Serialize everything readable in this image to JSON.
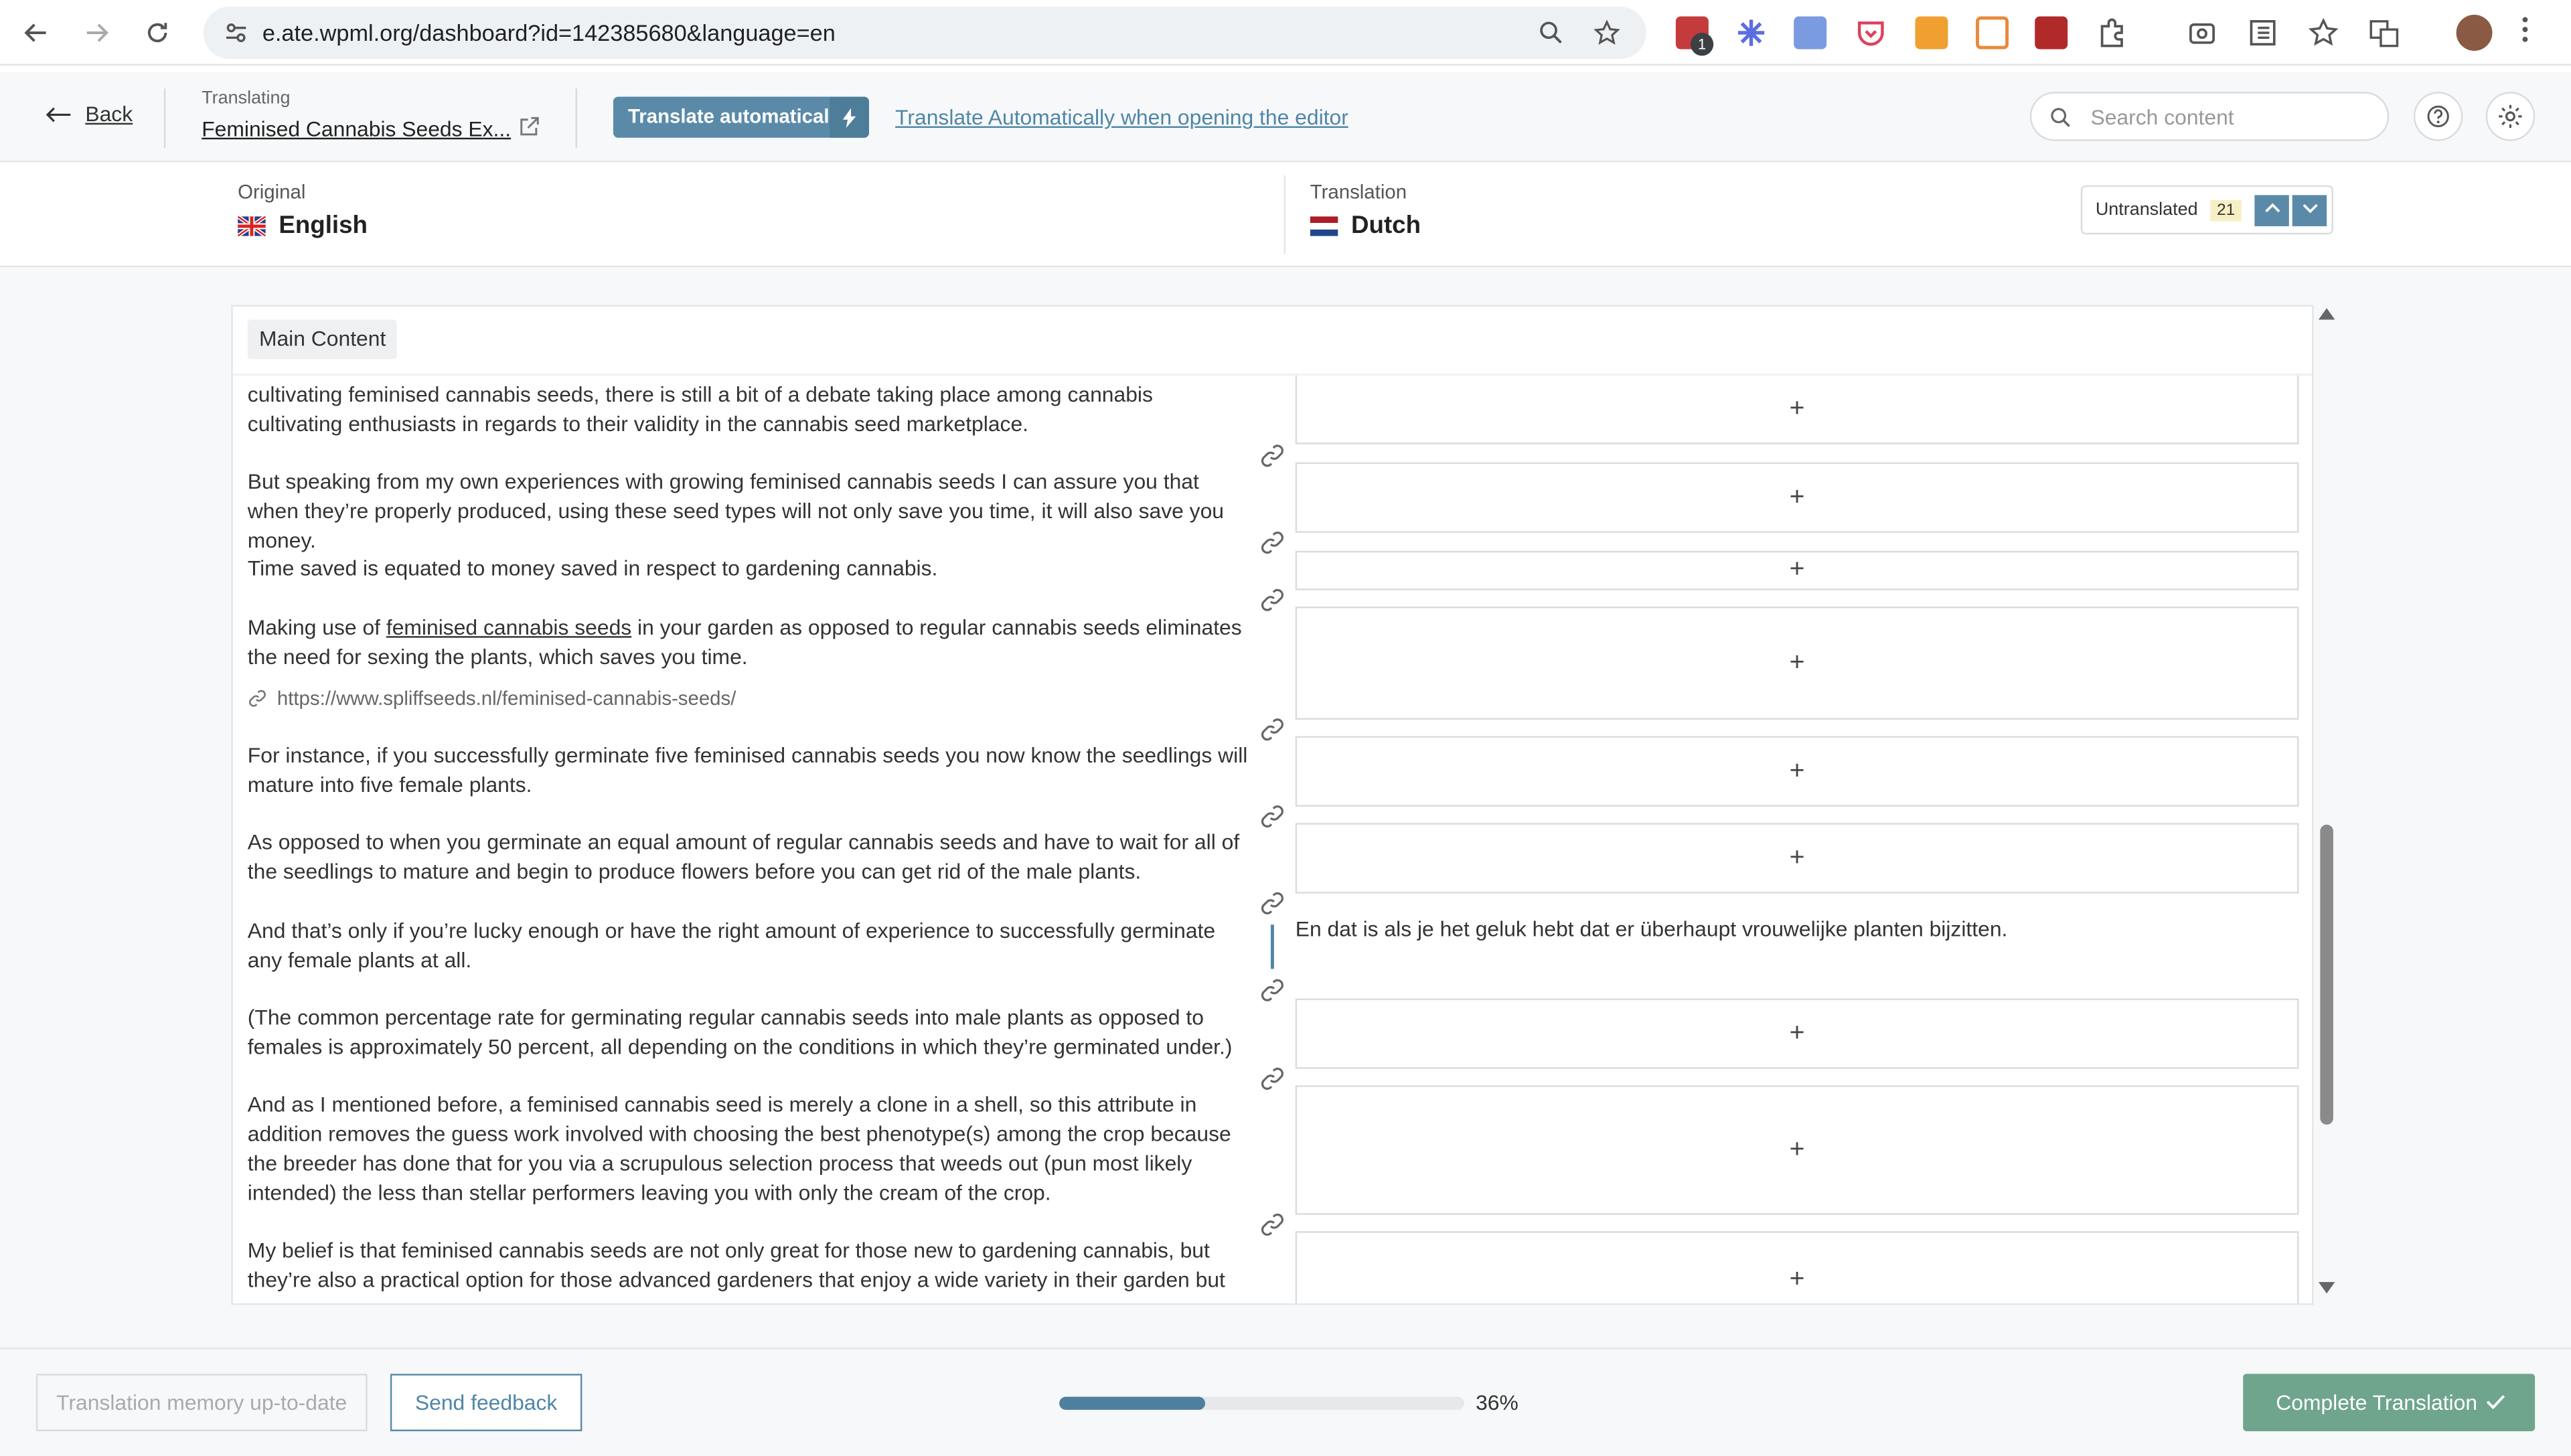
{
  "browser": {
    "url": "e.ate.wpml.org/dashboard?id=142385680&language=en",
    "ext_badge": "1"
  },
  "header": {
    "back_label": "Back",
    "translating_label": "Translating",
    "translating_title": "Feminised Cannabis Seeds Ex...",
    "auto_button": "Translate automatically",
    "auto_link": "Translate Automatically when opening the editor",
    "search_placeholder": "Search content"
  },
  "languages": {
    "original_label": "Original",
    "original_name": "English",
    "translation_label": "Translation",
    "translation_name": "Dutch",
    "untranslated_label": "Untranslated",
    "untranslated_count": "21"
  },
  "section_label": "Main Content",
  "segments": {
    "s1": "cultivating feminised cannabis seeds, there is still a bit of a debate taking place among cannabis cultivating enthusiasts in regards to their validity in the cannabis seed marketplace.",
    "s2": "But speaking from my own experiences with growing feminised cannabis seeds I can assure you that when they’re properly produced, using these seed types will not only save you time, it will also save you money.",
    "s3": "Time saved is equated to money saved in respect to gardening cannabis.",
    "s4_pre": "Making use of ",
    "s4_link": "feminised cannabis seeds",
    "s4_post": " in your garden as opposed to regular cannabis seeds eliminates the need for sexing the plants, which saves you time.",
    "s4_url": "https://www.spliffseeds.nl/feminised-cannabis-seeds/",
    "s5": "For instance, if you successfully germinate five feminised cannabis seeds you now know the seedlings will mature into five female plants.",
    "s6": "As opposed to when you germinate an equal amount of regular cannabis seeds and have to wait for all of the seedlings to mature and begin to produce flowers before you can get rid of the male plants.",
    "s7": "And that’s only if you’re lucky enough or have the right amount of experience to successfully germinate any female plants at all.",
    "s7_translation": "En dat is als je het geluk hebt dat er überhaupt vrouwelijke planten bijzitten.",
    "s8": "(The common percentage rate for germinating regular cannabis seeds into male plants as opposed to females is approximately 50 percent, all depending on the conditions in which they’re germinated under.)",
    "s9": "And as I mentioned before, a feminised cannabis seed is merely a clone in a shell, so this attribute in addition removes the guess work involved with choosing the best phenotype(s) among the crop because the breeder has done that for you via a scrupulous selection process that weeds out (pun most likely intended) the less than stellar performers leaving you with only the cream of the crop.",
    "s10": "My belief is that feminised cannabis seeds are not only great for those new to gardening cannabis, but they’re also a practical option for those advanced gardeners that enjoy a wide variety in their garden but"
  },
  "plus_glyph": "+",
  "footer": {
    "tm_button": "Translation memory up-to-date",
    "feedback_button": "Send feedback",
    "progress_value": 36,
    "progress_text": "36%",
    "complete_button": "Complete Translation"
  },
  "colors": {
    "accent": "#5a8aa8",
    "complete": "#6fa58c",
    "link": "#4f86a7"
  }
}
